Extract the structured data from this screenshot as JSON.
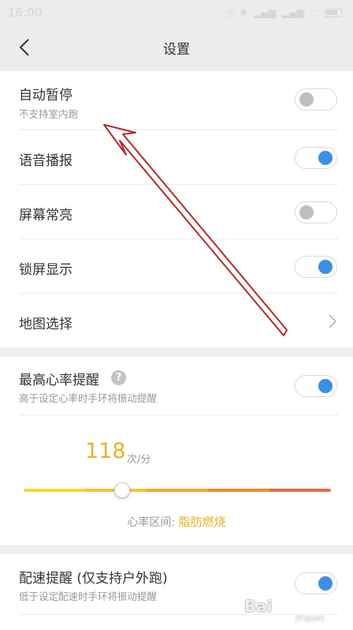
{
  "status_bar": {
    "time": "16:00",
    "icons": [
      "signal-icon",
      "wifi-icon",
      "bluetooth-icon",
      "battery-icon"
    ]
  },
  "header": {
    "title": "设置",
    "back_icon": "chevron-left-icon"
  },
  "settings": {
    "auto_pause": {
      "label": "自动暂停",
      "sub": "不支持室内跑",
      "enabled": false
    },
    "voice_broadcast": {
      "label": "语音播报",
      "enabled": true
    },
    "screen_on": {
      "label": "屏幕常亮",
      "enabled": false
    },
    "lock_screen_display": {
      "label": "锁屏显示",
      "enabled": true
    },
    "map_select": {
      "label": "地图选择"
    }
  },
  "heart_rate": {
    "label": "最高心率提醒",
    "help_glyph": "?",
    "sub": "高于设定心率时手环将振动提醒",
    "enabled": true,
    "value": "118",
    "unit": "次/分",
    "zone_label": "心率区间:",
    "zone_value": "脂肪燃烧",
    "slider_fraction": 0.32,
    "zone_colors": [
      "#f2d731",
      "#f2c232",
      "#f2aa2f",
      "#ef8b2f",
      "#ed6a3f"
    ]
  },
  "pace": {
    "label": "配速提醒 (仅支持户外跑)",
    "sub": "低于设定配速时手环将振动提醒",
    "enabled": true
  },
  "watermark": {
    "text": "Bai",
    "sub": "jingyan"
  },
  "colors": {
    "accent_blue": "#3d8ee4",
    "accent_yellow": "#e6b422",
    "annotation_arrow": "#b52a2a"
  }
}
